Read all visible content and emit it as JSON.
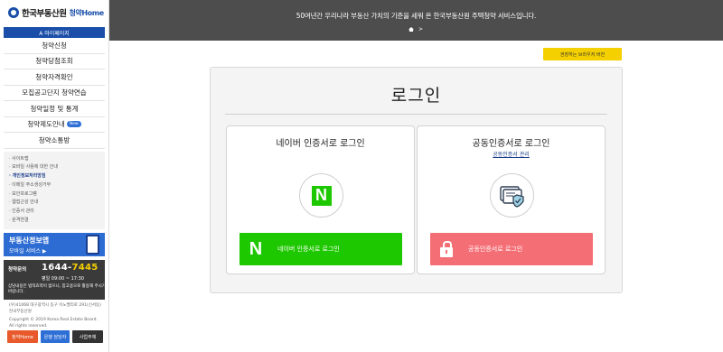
{
  "sidebar": {
    "logo_text": "한국부동산원",
    "logo_sub": "청약Home",
    "home_btn": "A 마이페이지",
    "menu": [
      {
        "label": "청약신청",
        "badge": ""
      },
      {
        "label": "청약당첨조회",
        "badge": ""
      },
      {
        "label": "청약자격확인",
        "badge": ""
      },
      {
        "label": "모집공고단지 청약연습",
        "badge": ""
      },
      {
        "label": "청약일정 및 통계",
        "badge": ""
      },
      {
        "label": "청약제도안내",
        "badge": "New"
      },
      {
        "label": "청약소통방",
        "badge": ""
      }
    ],
    "sub_links": [
      "· 사이트맵",
      "· 모바일 사용에 대한 안내",
      "· 개인정보처리방침",
      "· 이메일 주소생성거부",
      "· 보안프로그램",
      "· 웹접근성 안내",
      "· 인증서 관리",
      "· 원격연결"
    ],
    "app_banner": {
      "title": "부동산정보앱",
      "sub": "모바일 서비스 ▶"
    },
    "call": {
      "label": "청약문의",
      "number_prefix": "1644-",
      "number_suffix": "7445",
      "hours": "평일 09:00 ~ 17:30",
      "note": "상담내용은 법적효력이 없으니, 참고용으로 활용해 주시기 바랍니다."
    },
    "address": "(우)41068 대구광역시 동구 이노밸리로 291(신서동) 한국부동산원",
    "copyright": "Copyright © 2019 Korea Real Estate Board. All rights reserved.",
    "footer_buttons": [
      {
        "label": "청약Home",
        "color": "#e8592c"
      },
      {
        "label": "은행 담당자",
        "color": "#2e6fd6"
      },
      {
        "label": "사업주체",
        "color": "#333333"
      }
    ]
  },
  "topbar": {
    "text": "50여년간 우리나라 부동산 가치의 기준을 세워 온 한국부동산원 주택청약 서비스입니다.",
    "nav_sep": ">"
  },
  "browser_btn": "권장하는 브라우저 버전",
  "login": {
    "title": "로그인",
    "naver": {
      "title": "네이버 인증서로 로그인",
      "button": "네이버 인증서로 로그인",
      "mark": "N"
    },
    "cert": {
      "title": "공동인증서로 로그인",
      "link": "공동인증서 관리",
      "button": "공동인증서로 로그인"
    }
  },
  "colors": {
    "naver_green": "#1ec800",
    "cert_red": "#f46f75",
    "brand_blue": "#1a4ea8",
    "topbar": "#4d4d4d",
    "yellow": "#f5d000"
  }
}
